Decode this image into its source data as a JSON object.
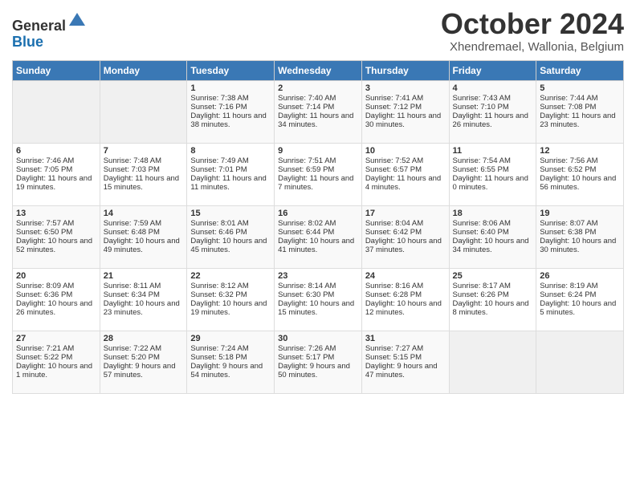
{
  "header": {
    "logo_line1": "General",
    "logo_line2": "Blue",
    "month_title": "October 2024",
    "location": "Xhendremael, Wallonia, Belgium"
  },
  "weekdays": [
    "Sunday",
    "Monday",
    "Tuesday",
    "Wednesday",
    "Thursday",
    "Friday",
    "Saturday"
  ],
  "rows": [
    [
      {
        "day": "",
        "sunrise": "",
        "sunset": "",
        "daylight": ""
      },
      {
        "day": "",
        "sunrise": "",
        "sunset": "",
        "daylight": ""
      },
      {
        "day": "1",
        "sunrise": "Sunrise: 7:38 AM",
        "sunset": "Sunset: 7:16 PM",
        "daylight": "Daylight: 11 hours and 38 minutes."
      },
      {
        "day": "2",
        "sunrise": "Sunrise: 7:40 AM",
        "sunset": "Sunset: 7:14 PM",
        "daylight": "Daylight: 11 hours and 34 minutes."
      },
      {
        "day": "3",
        "sunrise": "Sunrise: 7:41 AM",
        "sunset": "Sunset: 7:12 PM",
        "daylight": "Daylight: 11 hours and 30 minutes."
      },
      {
        "day": "4",
        "sunrise": "Sunrise: 7:43 AM",
        "sunset": "Sunset: 7:10 PM",
        "daylight": "Daylight: 11 hours and 26 minutes."
      },
      {
        "day": "5",
        "sunrise": "Sunrise: 7:44 AM",
        "sunset": "Sunset: 7:08 PM",
        "daylight": "Daylight: 11 hours and 23 minutes."
      }
    ],
    [
      {
        "day": "6",
        "sunrise": "Sunrise: 7:46 AM",
        "sunset": "Sunset: 7:05 PM",
        "daylight": "Daylight: 11 hours and 19 minutes."
      },
      {
        "day": "7",
        "sunrise": "Sunrise: 7:48 AM",
        "sunset": "Sunset: 7:03 PM",
        "daylight": "Daylight: 11 hours and 15 minutes."
      },
      {
        "day": "8",
        "sunrise": "Sunrise: 7:49 AM",
        "sunset": "Sunset: 7:01 PM",
        "daylight": "Daylight: 11 hours and 11 minutes."
      },
      {
        "day": "9",
        "sunrise": "Sunrise: 7:51 AM",
        "sunset": "Sunset: 6:59 PM",
        "daylight": "Daylight: 11 hours and 7 minutes."
      },
      {
        "day": "10",
        "sunrise": "Sunrise: 7:52 AM",
        "sunset": "Sunset: 6:57 PM",
        "daylight": "Daylight: 11 hours and 4 minutes."
      },
      {
        "day": "11",
        "sunrise": "Sunrise: 7:54 AM",
        "sunset": "Sunset: 6:55 PM",
        "daylight": "Daylight: 11 hours and 0 minutes."
      },
      {
        "day": "12",
        "sunrise": "Sunrise: 7:56 AM",
        "sunset": "Sunset: 6:52 PM",
        "daylight": "Daylight: 10 hours and 56 minutes."
      }
    ],
    [
      {
        "day": "13",
        "sunrise": "Sunrise: 7:57 AM",
        "sunset": "Sunset: 6:50 PM",
        "daylight": "Daylight: 10 hours and 52 minutes."
      },
      {
        "day": "14",
        "sunrise": "Sunrise: 7:59 AM",
        "sunset": "Sunset: 6:48 PM",
        "daylight": "Daylight: 10 hours and 49 minutes."
      },
      {
        "day": "15",
        "sunrise": "Sunrise: 8:01 AM",
        "sunset": "Sunset: 6:46 PM",
        "daylight": "Daylight: 10 hours and 45 minutes."
      },
      {
        "day": "16",
        "sunrise": "Sunrise: 8:02 AM",
        "sunset": "Sunset: 6:44 PM",
        "daylight": "Daylight: 10 hours and 41 minutes."
      },
      {
        "day": "17",
        "sunrise": "Sunrise: 8:04 AM",
        "sunset": "Sunset: 6:42 PM",
        "daylight": "Daylight: 10 hours and 37 minutes."
      },
      {
        "day": "18",
        "sunrise": "Sunrise: 8:06 AM",
        "sunset": "Sunset: 6:40 PM",
        "daylight": "Daylight: 10 hours and 34 minutes."
      },
      {
        "day": "19",
        "sunrise": "Sunrise: 8:07 AM",
        "sunset": "Sunset: 6:38 PM",
        "daylight": "Daylight: 10 hours and 30 minutes."
      }
    ],
    [
      {
        "day": "20",
        "sunrise": "Sunrise: 8:09 AM",
        "sunset": "Sunset: 6:36 PM",
        "daylight": "Daylight: 10 hours and 26 minutes."
      },
      {
        "day": "21",
        "sunrise": "Sunrise: 8:11 AM",
        "sunset": "Sunset: 6:34 PM",
        "daylight": "Daylight: 10 hours and 23 minutes."
      },
      {
        "day": "22",
        "sunrise": "Sunrise: 8:12 AM",
        "sunset": "Sunset: 6:32 PM",
        "daylight": "Daylight: 10 hours and 19 minutes."
      },
      {
        "day": "23",
        "sunrise": "Sunrise: 8:14 AM",
        "sunset": "Sunset: 6:30 PM",
        "daylight": "Daylight: 10 hours and 15 minutes."
      },
      {
        "day": "24",
        "sunrise": "Sunrise: 8:16 AM",
        "sunset": "Sunset: 6:28 PM",
        "daylight": "Daylight: 10 hours and 12 minutes."
      },
      {
        "day": "25",
        "sunrise": "Sunrise: 8:17 AM",
        "sunset": "Sunset: 6:26 PM",
        "daylight": "Daylight: 10 hours and 8 minutes."
      },
      {
        "day": "26",
        "sunrise": "Sunrise: 8:19 AM",
        "sunset": "Sunset: 6:24 PM",
        "daylight": "Daylight: 10 hours and 5 minutes."
      }
    ],
    [
      {
        "day": "27",
        "sunrise": "Sunrise: 7:21 AM",
        "sunset": "Sunset: 5:22 PM",
        "daylight": "Daylight: 10 hours and 1 minute."
      },
      {
        "day": "28",
        "sunrise": "Sunrise: 7:22 AM",
        "sunset": "Sunset: 5:20 PM",
        "daylight": "Daylight: 9 hours and 57 minutes."
      },
      {
        "day": "29",
        "sunrise": "Sunrise: 7:24 AM",
        "sunset": "Sunset: 5:18 PM",
        "daylight": "Daylight: 9 hours and 54 minutes."
      },
      {
        "day": "30",
        "sunrise": "Sunrise: 7:26 AM",
        "sunset": "Sunset: 5:17 PM",
        "daylight": "Daylight: 9 hours and 50 minutes."
      },
      {
        "day": "31",
        "sunrise": "Sunrise: 7:27 AM",
        "sunset": "Sunset: 5:15 PM",
        "daylight": "Daylight: 9 hours and 47 minutes."
      },
      {
        "day": "",
        "sunrise": "",
        "sunset": "",
        "daylight": ""
      },
      {
        "day": "",
        "sunrise": "",
        "sunset": "",
        "daylight": ""
      }
    ]
  ]
}
